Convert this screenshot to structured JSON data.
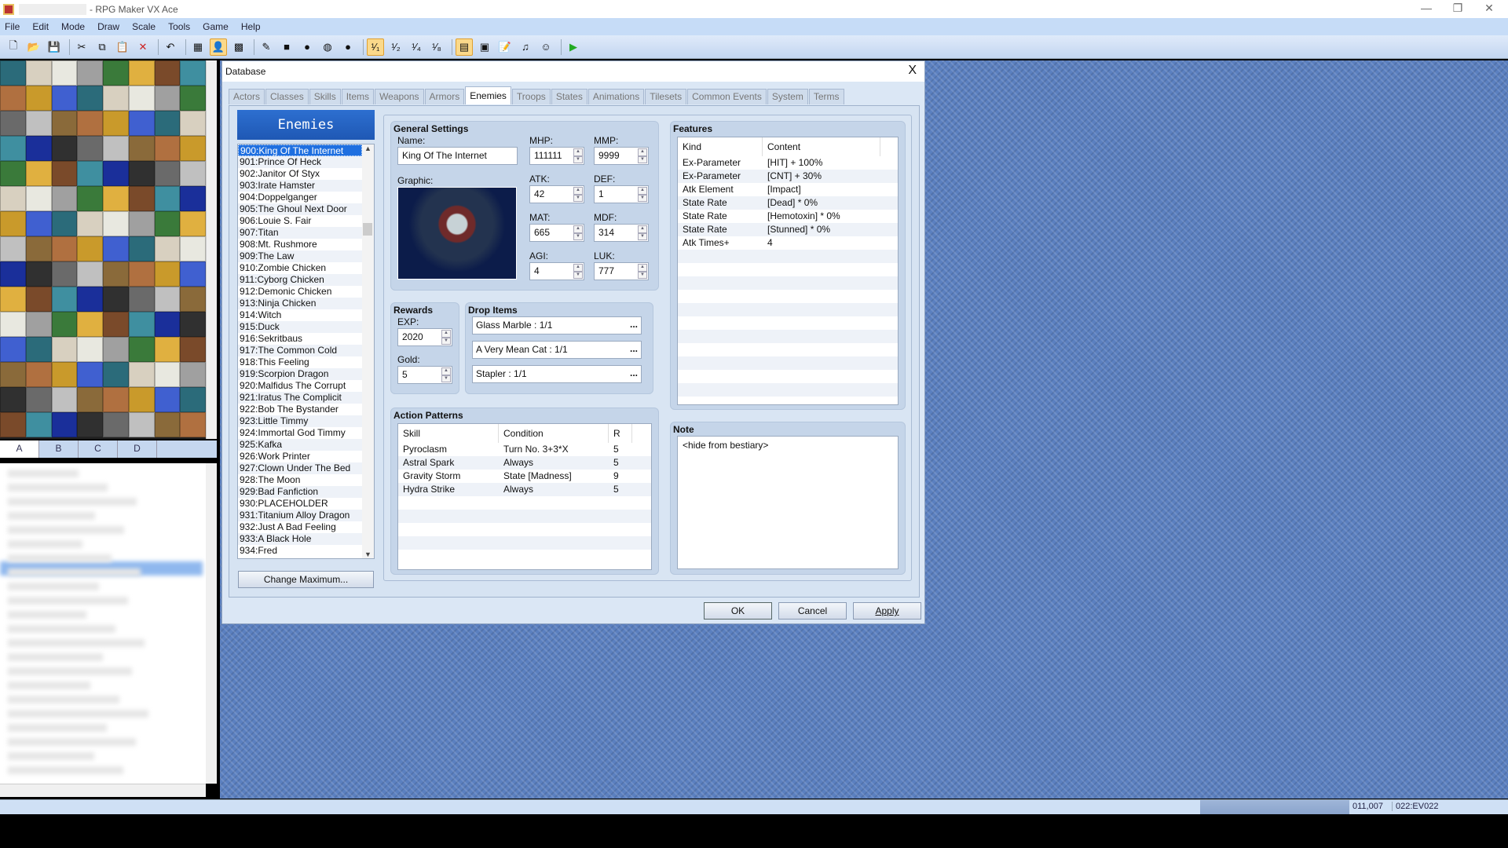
{
  "app": {
    "title": "- RPG Maker VX Ace",
    "menu": [
      "File",
      "Edit",
      "Mode",
      "Draw",
      "Scale",
      "Tools",
      "Game",
      "Help"
    ]
  },
  "toolbar": {
    "icons": [
      "new-project-icon",
      "open-project-icon",
      "save-icon",
      "|",
      "cut-icon",
      "copy-icon",
      "paste-icon",
      "delete-icon",
      "|",
      "undo-icon",
      "|",
      "map-layer-icon",
      "event-layer-icon",
      "region-icon",
      "|",
      "pencil-icon",
      "rectangle-icon",
      "ellipse-icon",
      "flood-fill-icon",
      "shadow-pen-icon",
      "|",
      "zoom-1-1-icon",
      "zoom-1-2-icon",
      "zoom-1-4-icon",
      "zoom-1-8-icon",
      "|",
      "database-icon",
      "resource-manager-icon",
      "script-editor-icon",
      "sound-test-icon",
      "character-generator-icon",
      "|",
      "playtest-icon"
    ],
    "glyphs": [
      "🗋",
      "📂",
      "💾",
      "|",
      "✂",
      "⧉",
      "📋",
      "✕",
      "|",
      "↶",
      "|",
      "▦",
      "👤",
      "▩",
      "|",
      "✎",
      "■",
      "●",
      "◍",
      "●",
      "|",
      "¹⁄₁",
      "¹⁄₂",
      "¹⁄₄",
      "¹⁄₈",
      "|",
      "▤",
      "▣",
      "📝",
      "♫",
      "☺",
      "|",
      "▶"
    ],
    "active": [
      12,
      21,
      26
    ]
  },
  "tileset": {
    "tabs": [
      "A",
      "B",
      "C",
      "D"
    ],
    "active": "A"
  },
  "status": {
    "coords": "011,007",
    "event": "022:EV022"
  },
  "database": {
    "title": "Database",
    "close": "X",
    "tabs": [
      "Actors",
      "Classes",
      "Skills",
      "Items",
      "Weapons",
      "Armors",
      "Enemies",
      "Troops",
      "States",
      "Animations",
      "Tilesets",
      "Common Events",
      "System",
      "Terms"
    ],
    "active_tab": "Enemies",
    "list_header": "Enemies",
    "enemies": [
      "900:King Of The Internet",
      "901:Prince Of Heck",
      "902:Janitor Of Styx",
      "903:Irate Hamster",
      "904:Doppelganger",
      "905:The Ghoul Next Door",
      "906:Louie S. Fair",
      "907:Titan",
      "908:Mt. Rushmore",
      "909:The Law",
      "910:Zombie Chicken",
      "911:Cyborg Chicken",
      "912:Demonic Chicken",
      "913:Ninja Chicken",
      "914:Witch",
      "915:Duck",
      "916:Sekritbaus",
      "917:The Common Cold",
      "918:This Feeling",
      "919:Scorpion Dragon",
      "920:Malfidus The Corrupt",
      "921:Iratus The Complicit",
      "922:Bob The Bystander",
      "923:Little Timmy",
      "924:Immortal God Timmy",
      "925:Kafka",
      "926:Work Printer",
      "927:Clown Under The Bed",
      "928:The Moon",
      "929:Bad Fanfiction",
      "930:PLACEHOLDER",
      "931:Titanium Alloy Dragon",
      "932:Just A Bad Feeling",
      "933:A Black Hole",
      "934:Fred"
    ],
    "selected_index": 0,
    "change_max": "Change Maximum...",
    "general": {
      "title": "General Settings",
      "name_label": "Name:",
      "name": "King Of The Internet",
      "graphic_label": "Graphic:",
      "mhp_label": "MHP:",
      "mhp": "111111",
      "mmp_label": "MMP:",
      "mmp": "9999",
      "atk_label": "ATK:",
      "atk": "42",
      "def_label": "DEF:",
      "def": "1",
      "mat_label": "MAT:",
      "mat": "665",
      "mdf_label": "MDF:",
      "mdf": "314",
      "agi_label": "AGI:",
      "agi": "4",
      "luk_label": "LUK:",
      "luk": "777"
    },
    "rewards": {
      "title": "Rewards",
      "exp_label": "EXP:",
      "exp": "2020",
      "gold_label": "Gold:",
      "gold": "5"
    },
    "drops": {
      "title": "Drop Items",
      "items": [
        "Glass Marble : 1/1",
        "A Very Mean Cat : 1/1",
        "Stapler : 1/1"
      ],
      "more": "..."
    },
    "actions": {
      "title": "Action Patterns",
      "headers": [
        "Skill",
        "Condition",
        "R"
      ],
      "rows": [
        [
          "Pyroclasm",
          "Turn No. 3+3*X",
          "5"
        ],
        [
          "Astral Spark",
          "Always",
          "5"
        ],
        [
          "Gravity Storm",
          "State [Madness]",
          "9"
        ],
        [
          "Hydra Strike",
          "Always",
          "5"
        ]
      ]
    },
    "features": {
      "title": "Features",
      "headers": [
        "Kind",
        "Content"
      ],
      "rows": [
        [
          "Ex-Parameter",
          "[HIT] + 100%"
        ],
        [
          "Ex-Parameter",
          "[CNT] + 30%"
        ],
        [
          "Atk Element",
          "[Impact]"
        ],
        [
          "State Rate",
          "[Dead] * 0%"
        ],
        [
          "State Rate",
          "[Hemotoxin] * 0%"
        ],
        [
          "State Rate",
          "[Stunned] * 0%"
        ],
        [
          "Atk Times+",
          "4"
        ]
      ]
    },
    "note": {
      "title": "Note",
      "text": "<hide from bestiary>"
    },
    "buttons": {
      "ok": "OK",
      "cancel": "Cancel",
      "apply": "Apply"
    }
  }
}
